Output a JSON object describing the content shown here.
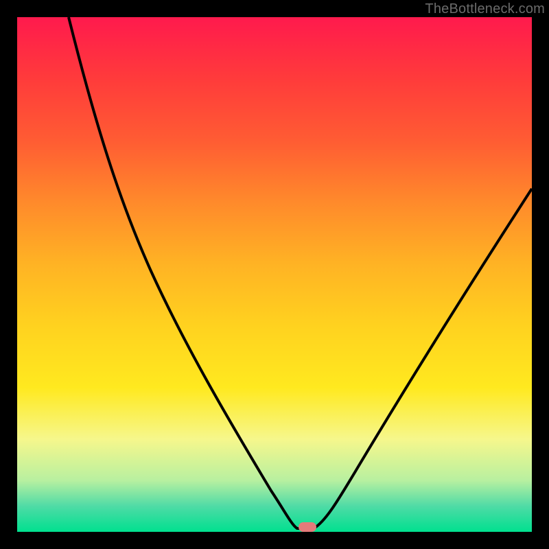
{
  "watermark": "TheBottleneck.com",
  "colors": {
    "background": "#000000",
    "curve": "#000000",
    "marker": "#e47a7a",
    "gradient_top": "#ff1a4d",
    "gradient_bottom": "#00e08f"
  },
  "chart_data": {
    "type": "line",
    "title": "",
    "xlabel": "",
    "ylabel": "",
    "xlim": [
      0,
      100
    ],
    "ylim": [
      0,
      100
    ],
    "series": [
      {
        "name": "bottleneck-curve",
        "x": [
          0,
          5,
          10,
          15,
          20,
          25,
          30,
          35,
          40,
          45,
          50,
          52,
          55,
          57,
          60,
          65,
          70,
          75,
          80,
          85,
          90,
          95,
          100
        ],
        "values": [
          100,
          95,
          89,
          82,
          74,
          65,
          55,
          44,
          33,
          21,
          9,
          2,
          0,
          0,
          3,
          12,
          22,
          32,
          41,
          49,
          56,
          62,
          67
        ]
      }
    ],
    "annotations": [
      {
        "name": "optimal-marker",
        "x": 56,
        "y": 0
      }
    ]
  }
}
